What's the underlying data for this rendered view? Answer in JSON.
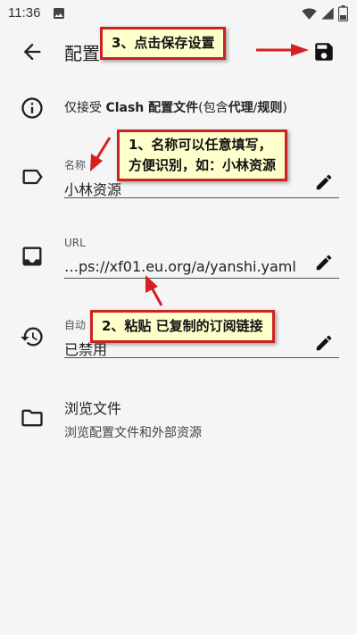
{
  "status_bar": {
    "time": "11:36",
    "icons": [
      "gallery-icon",
      "wifi-icon",
      "signal-icon",
      "battery-icon"
    ]
  },
  "app_bar": {
    "title": "配置",
    "back_icon": "arrow-back-icon",
    "save_icon": "save-icon"
  },
  "info": {
    "icon": "info-icon",
    "text_prefix": "仅接受 ",
    "text_bold1": "Clash 配置文件",
    "text_mid": "(包含",
    "text_bold2": "代理",
    "text_sep": "/",
    "text_bold3": "规则",
    "text_suffix": ")"
  },
  "name_field": {
    "icon": "label-icon",
    "label": "名称",
    "value": "小林资源",
    "edit_icon": "edit-icon"
  },
  "url_field": {
    "icon": "inbox-icon",
    "label": "URL",
    "value": "…ps://xf01.eu.org/a/yanshi.yaml",
    "edit_icon": "edit-icon"
  },
  "auto_update_field": {
    "icon": "history-icon",
    "label": "自动",
    "value": "已禁用",
    "edit_icon": "edit-icon"
  },
  "browse": {
    "icon": "folder-icon",
    "title": "浏览文件",
    "subtitle": "浏览配置文件和外部资源"
  },
  "annotations": {
    "save_tip": "3、点击保存设置",
    "name_tip_line1": "1、名称可以任意填写，",
    "name_tip_line2": "方便识别，如：小林资源",
    "url_tip": "2、粘贴 已复制的订阅链接"
  },
  "colors": {
    "background": "#f5f5f5",
    "callout_fill": "#ffffcc",
    "callout_border": "#cc2222",
    "arrow": "#d42020"
  }
}
